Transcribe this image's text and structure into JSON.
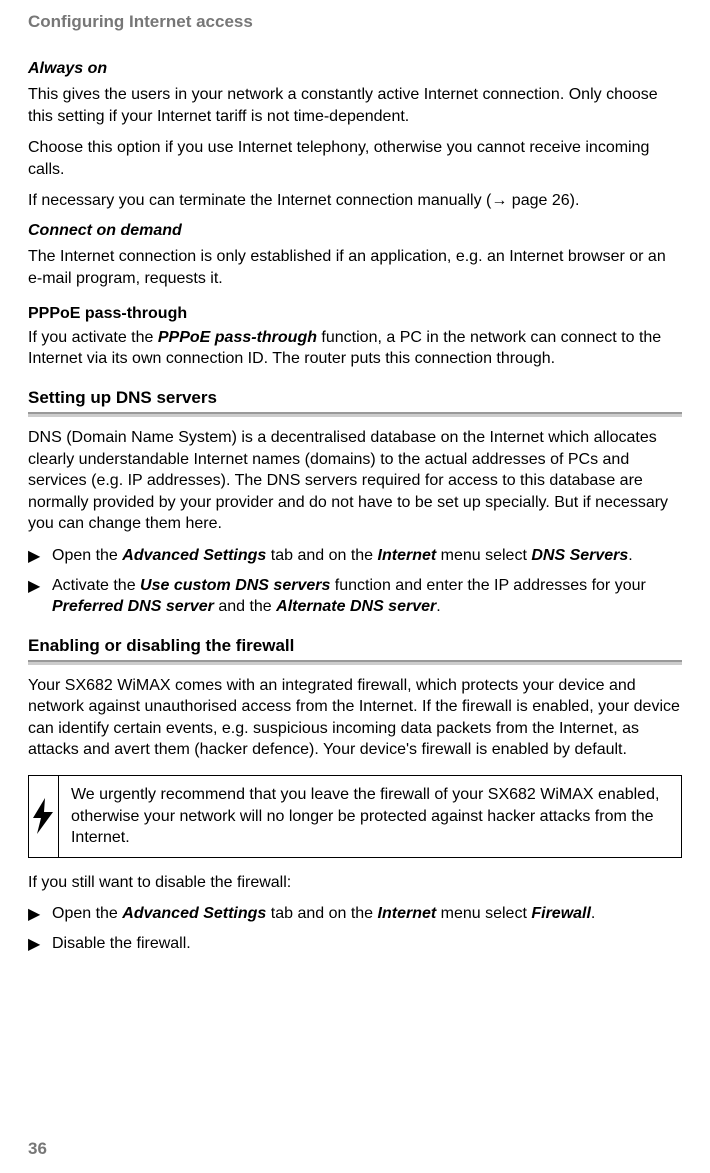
{
  "header": "Configuring Internet access",
  "alwaysOn": {
    "title": "Always on",
    "p1": "This gives the users in your network a constantly active Internet connection. Only choose this setting if your Internet tariff is not time-dependent.",
    "p2": "Choose this option if you use Internet telephony, otherwise you cannot receive incoming calls.",
    "p3_a": "If necessary you can terminate the Internet connection manually (",
    "p3_arrow": "→",
    "p3_b": " page 26)."
  },
  "connectOnDemand": {
    "title": "Connect on demand",
    "p1": "The Internet connection is only established if an application, e.g. an Internet browser or an e-mail program, requests it."
  },
  "pppoe": {
    "title": "PPPoE pass-through",
    "p1_a": "If you activate the ",
    "p1_b": "PPPoE pass-through",
    "p1_c": " function, a PC in the network can connect to the Internet via its own connection ID. The router puts this connection through."
  },
  "dns": {
    "title": "Setting up DNS servers",
    "p1": "DNS (Domain Name System) is a decentralised database on the Internet which allocates clearly understandable Internet names (domains) to the actual addresses of PCs and services (e.g. IP addresses). The DNS servers required for access to this database are normally provided by your provider and do not have to be set up specially. But if necessary you can change them here.",
    "b1_a": "Open the ",
    "b1_b": "Advanced Settings",
    "b1_c": " tab and on the ",
    "b1_d": "Internet",
    "b1_e": " menu select ",
    "b1_f": "DNS Servers",
    "b1_g": ".",
    "b2_a": "Activate the ",
    "b2_b": "Use custom DNS servers",
    "b2_c": " function and enter the IP addresses for your ",
    "b2_d": "Preferred DNS server",
    "b2_e": " and the ",
    "b2_f": "Alternate DNS server",
    "b2_g": "."
  },
  "firewall": {
    "title": "Enabling or disabling the firewall",
    "p1": "Your SX682 WiMAX comes with an integrated firewall, which protects your device and network against unauthorised access from the Internet. If the firewall is enabled, your device can identify certain events, e.g. suspicious incoming data packets from the Internet, as attacks and avert them (hacker defence). Your device's firewall is enabled by default.",
    "warn": "We urgently recommend that you leave the firewall of your SX682 WiMAX enabled, otherwise your network will no longer be protected against hacker attacks from the Internet.",
    "p2": "If you still want to disable the firewall:",
    "b1_a": "Open the ",
    "b1_b": "Advanced Settings",
    "b1_c": " tab and on the ",
    "b1_d": "Internet",
    "b1_e": " menu select ",
    "b1_f": "Firewall",
    "b1_g": ".",
    "b2": "Disable the firewall."
  },
  "bulletMarker": "▶",
  "pageNumber": "36"
}
